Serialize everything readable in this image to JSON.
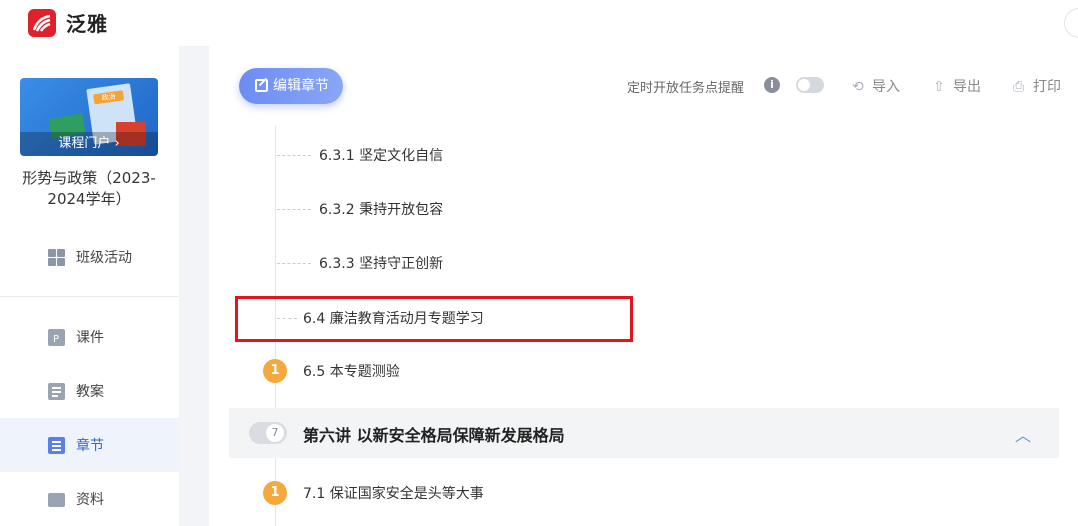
{
  "app": {
    "brand": "泛雅"
  },
  "sidebar": {
    "cover_tag": "政治",
    "portal_label": "课程门户 ›",
    "course_title": "形势与政策（2023-2024学年）",
    "items": [
      {
        "label": "班级活动",
        "icon": "grid-icon"
      },
      {
        "label": "课件",
        "icon": "ppt-file-icon"
      },
      {
        "label": "教案",
        "icon": "lesson-plan-icon"
      },
      {
        "label": "章节",
        "icon": "chapter-list-icon",
        "active": true
      },
      {
        "label": "资料",
        "icon": "folder-icon"
      }
    ]
  },
  "toolbar": {
    "edit_label": "编辑章节",
    "reminder_label": "定时开放任务点提醒",
    "info_glyph": "i",
    "reminder_enabled": false,
    "import_label": "导入",
    "export_label": "导出",
    "print_label": "打印"
  },
  "tree": {
    "items": [
      {
        "label": "6.3.1 坚定文化自信",
        "level": 3
      },
      {
        "label": "6.3.2 秉持开放包容",
        "level": 3
      },
      {
        "label": "6.3.3 坚持守正创新",
        "level": 3
      },
      {
        "label": "6.4 廉洁教育活动月专题学习",
        "level": 2,
        "highlighted": true
      },
      {
        "label": "6.5 本专题测验",
        "level": 2,
        "badge": "1"
      }
    ],
    "chapter": {
      "number": "7",
      "title": "第六讲 以新安全格局保障新发展格局",
      "caret": "︿"
    },
    "after_chapter": [
      {
        "label": "7.1 保证国家安全是头等大事",
        "level": 2,
        "badge": "1"
      }
    ]
  },
  "colors": {
    "accent": "#3a63d8",
    "badge": "#f5a83b",
    "highlight": "#e0161c",
    "logo": "#e0202b"
  }
}
